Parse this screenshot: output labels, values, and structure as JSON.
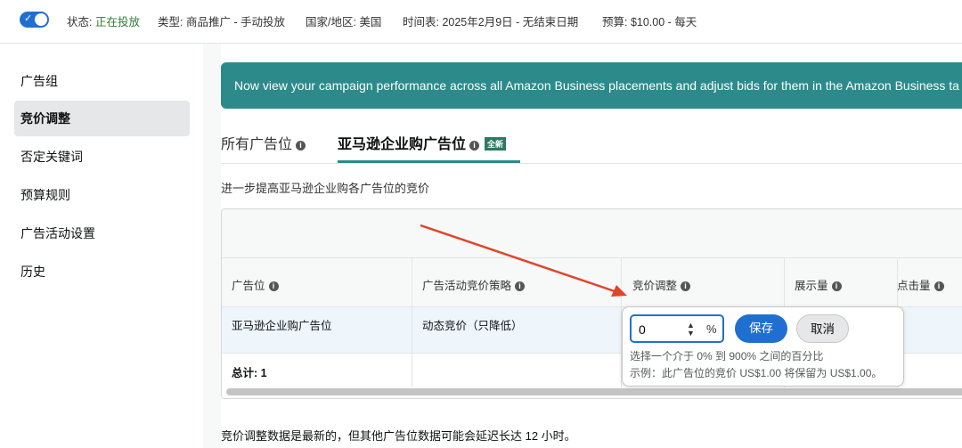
{
  "topbar": {
    "status_label": "状态:",
    "status_value": "正在投放",
    "type": "类型: 商品推广 - 手动投放",
    "country": "国家/地区: 美国",
    "schedule": "时间表: 2025年2月9日 - 无结束日期",
    "budget": "预算: $10.00 - 每天"
  },
  "sidebar": {
    "items": [
      {
        "label": "广告组"
      },
      {
        "label": "竞价调整"
      },
      {
        "label": "否定关键词"
      },
      {
        "label": "预算规则"
      },
      {
        "label": "广告活动设置"
      },
      {
        "label": "历史"
      }
    ]
  },
  "banner": {
    "text": "Now view your campaign performance across all Amazon Business placements and adjust bids for them in the Amazon Business ta"
  },
  "tabs": [
    {
      "label": "所有广告位"
    },
    {
      "label": "亚马逊企业购广告位",
      "badge": "全新"
    }
  ],
  "subtitle": "进一步提高亚马逊企业购各广告位的竞价",
  "table": {
    "headers": [
      "广告位",
      "广告活动竞价策略",
      "竞价调整",
      "展示量",
      "点击量"
    ],
    "row": {
      "placement": "亚马逊企业购广告位",
      "strategy": "动态竞价（只降低）"
    },
    "total": "总计: 1"
  },
  "popover": {
    "input_value": "0",
    "percent": "%",
    "save": "保存",
    "cancel": "取消",
    "hint1": "选择一个介于 0% 到 900% 之间的百分比",
    "hint2": "示例：此广告位的竞价 US$1.00 将保留为 US$1.00。"
  },
  "footnote": "竞价调整数据是最新的，但其他广告位数据可能会延迟长达 12 小时。",
  "icons": {
    "info": "info-icon",
    "check": "check-icon",
    "spinner": "spinner-arrows-icon",
    "arrow": "annotation-arrow"
  },
  "colors": {
    "accent": "#1f6fd1",
    "banner": "#2c8a8a",
    "status_green": "#2e7d32",
    "arrow": "#e0452b"
  }
}
